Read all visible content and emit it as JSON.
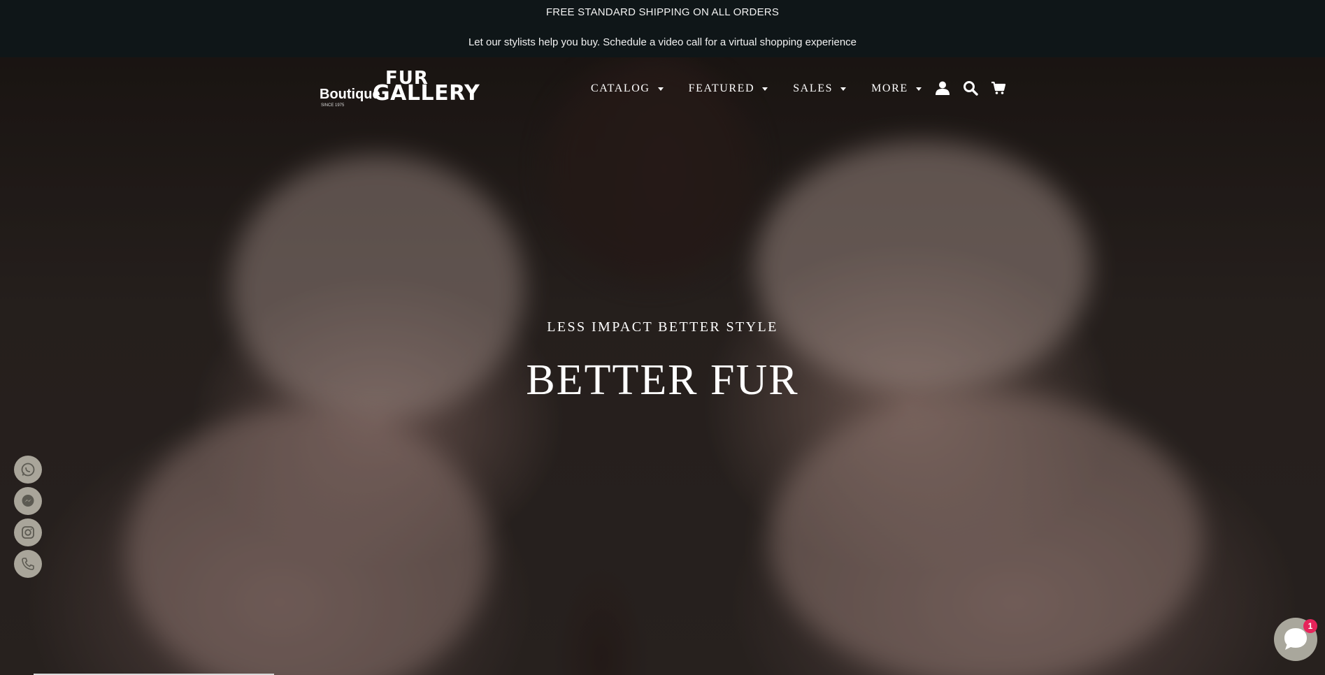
{
  "announcement": {
    "shipping": "FREE STANDARD SHIPPING ON ALL ORDERS",
    "stylist": "Let our stylists help you buy. Schedule a video call for a virtual shopping experience"
  },
  "logo": {
    "fur": "FUR",
    "boutique": "Boutique",
    "gallery": "GALLERY",
    "since": "SINCE 1975"
  },
  "nav": {
    "items": [
      {
        "label": "CATALOG"
      },
      {
        "label": "FEATURED"
      },
      {
        "label": "SALES"
      },
      {
        "label": "MORE"
      }
    ]
  },
  "header_icons": [
    "account-icon",
    "search-icon",
    "cart-icon"
  ],
  "hero": {
    "subtitle": "LESS IMPACT BETTER STYLE",
    "title": "BETTER FUR"
  },
  "social": [
    "whatsapp-icon",
    "messenger-icon",
    "instagram-icon",
    "phone-icon"
  ],
  "chat": {
    "badge": "1"
  },
  "colors": {
    "announcement_bg": "#0f1618",
    "social_bg": "#a9a59a",
    "badge": "#e6245a"
  }
}
